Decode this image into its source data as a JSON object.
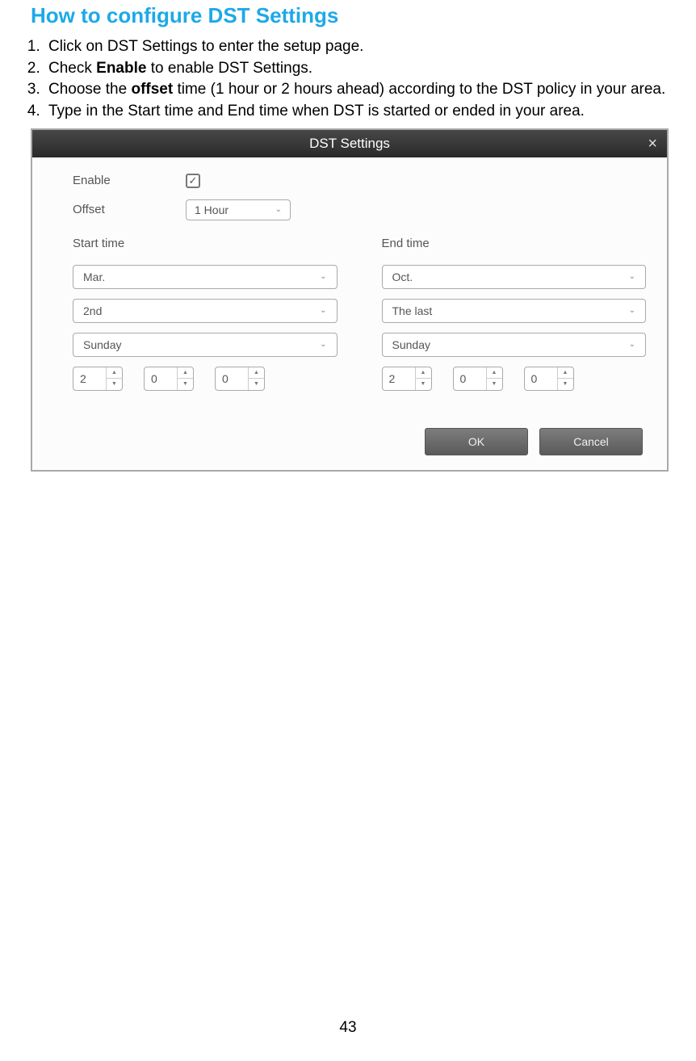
{
  "heading": "How to configure DST Settings",
  "steps": [
    {
      "pre": "Click on DST Settings to enter the setup page."
    },
    {
      "pre": "Check ",
      "bold": "Enable",
      "post": " to enable DST Settings."
    },
    {
      "pre": "Choose the ",
      "bold": "offset",
      "post": " time (1 hour or 2 hours ahead) according to the DST policy in your area."
    },
    {
      "pre": "Type in the Start time and End time when DST is started or ended in your area."
    }
  ],
  "dialog": {
    "title": "DST Settings",
    "close": "×",
    "enable_label": "Enable",
    "enable_check": "✓",
    "offset_label": "Offset",
    "offset_value": "1 Hour",
    "chevron": "⌄",
    "start": {
      "label": "Start time",
      "month": "Mar.",
      "week": "2nd",
      "day": "Sunday",
      "h": "2",
      "m": "0",
      "s": "0"
    },
    "end": {
      "label": "End time",
      "month": "Oct.",
      "week": "The last",
      "day": "Sunday",
      "h": "2",
      "m": "0",
      "s": "0"
    },
    "arrow_up": "▲",
    "arrow_down": "▼",
    "ok": "OK",
    "cancel": "Cancel"
  },
  "page_number": "43"
}
